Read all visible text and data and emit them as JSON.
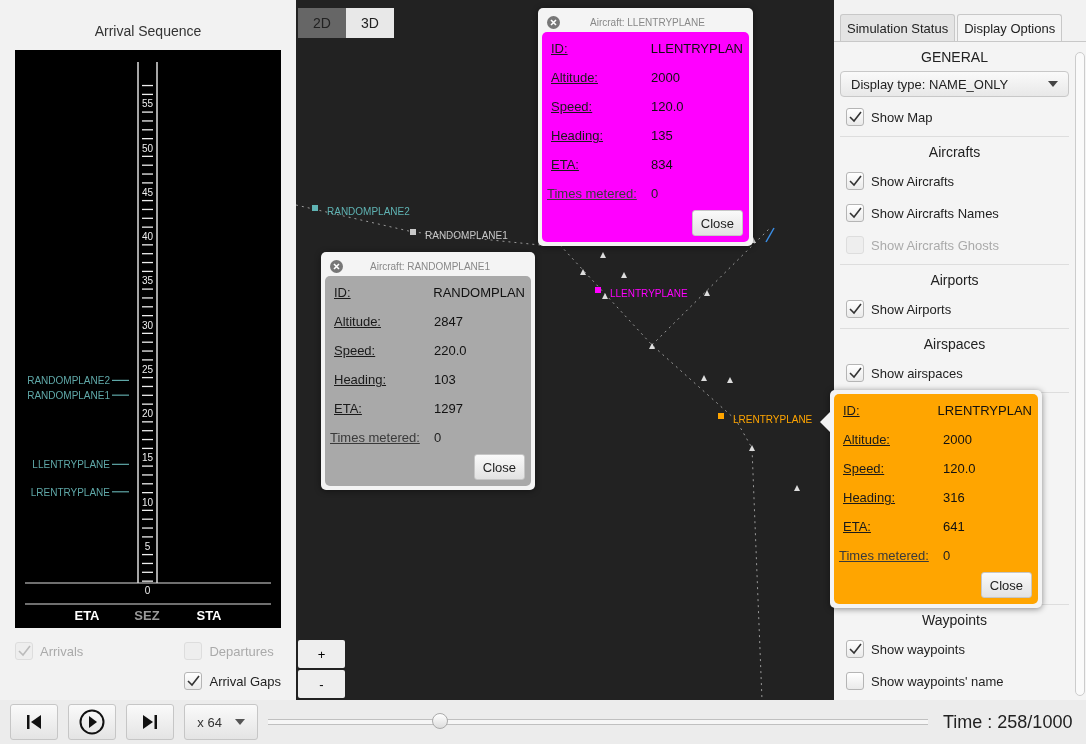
{
  "arrival_sequence": {
    "title": "Arrival Sequence",
    "scale_labels": [
      "55",
      "50",
      "45",
      "40",
      "35",
      "30",
      "25",
      "20",
      "15",
      "10",
      "5",
      "0"
    ],
    "flights": [
      "RANDOMPLANE2",
      "RANDOMPLANE1",
      "LLENTRYPLANE",
      "LRENTRYPLANE"
    ],
    "columns": [
      {
        "label": "ETA",
        "disabled": false
      },
      {
        "label": "SEZ",
        "disabled": true
      },
      {
        "label": "STA",
        "disabled": false
      }
    ],
    "options": [
      {
        "label": "Arrivals",
        "checked": true,
        "disabled": true
      },
      {
        "label": "Departures",
        "checked": false,
        "disabled": true
      },
      {
        "label": "Arrival Gaps",
        "checked": true,
        "disabled": false
      }
    ]
  },
  "map": {
    "view_buttons": [
      {
        "label": "2D",
        "selected": true
      },
      {
        "label": "3D",
        "selected": false
      }
    ],
    "aircraft": [
      {
        "label": "RANDOMPLANE2",
        "color": "#5fb3b3"
      },
      {
        "label": "RANDOMPLANE1",
        "color": "#c8c8c8"
      },
      {
        "label": "LLENTRYPLANE",
        "color": "#ff00ff"
      },
      {
        "label": "LRENTRYPLANE",
        "color": "#ffa500"
      }
    ],
    "zoom_buttons": [
      "+",
      "-"
    ]
  },
  "popups": [
    {
      "title": "Aircraft: LLENTRYPLANE",
      "color": "#ff00ff",
      "fields": [
        {
          "label": "ID:",
          "value": "LLENTRYPLAN",
          "kind": "property"
        },
        {
          "label": "Altitude:",
          "value": "2000",
          "kind": "property"
        },
        {
          "label": "Speed:",
          "value": "120.0",
          "kind": "property"
        },
        {
          "label": "Heading:",
          "value": "135",
          "kind": "property"
        },
        {
          "label": "ETA:",
          "value": "834",
          "kind": "property"
        },
        {
          "label": "Times metered:",
          "value": "0",
          "kind": "count"
        }
      ],
      "button": "Close"
    },
    {
      "title": "Aircraft: RANDOMPLANE1",
      "color": "#a9a9a9",
      "fields": [
        {
          "label": "ID:",
          "value": "RANDOMPLAN",
          "kind": "property"
        },
        {
          "label": "Altitude:",
          "value": "2847",
          "kind": "property"
        },
        {
          "label": "Speed:",
          "value": "220.0",
          "kind": "property"
        },
        {
          "label": "Heading:",
          "value": "103",
          "kind": "property"
        },
        {
          "label": "ETA:",
          "value": "1297",
          "kind": "property"
        },
        {
          "label": "Times metered:",
          "value": "0",
          "kind": "count"
        }
      ],
      "button": "Close"
    },
    {
      "color": "#ffa500",
      "fields": [
        {
          "label": "ID:",
          "value": "LRENTRYPLAN",
          "kind": "property"
        },
        {
          "label": "Altitude:",
          "value": "2000",
          "kind": "property"
        },
        {
          "label": "Speed:",
          "value": "120.0",
          "kind": "property"
        },
        {
          "label": "Heading:",
          "value": "316",
          "kind": "property"
        },
        {
          "label": "ETA:",
          "value": "641",
          "kind": "property"
        },
        {
          "label": "Times metered:",
          "value": "0",
          "kind": "count"
        }
      ],
      "button": "Close"
    }
  ],
  "side_panel": {
    "tabs": [
      {
        "label": "Simulation Status",
        "selected": false
      },
      {
        "label": "Display Options",
        "selected": true
      }
    ],
    "sections": [
      {
        "title": "GENERAL",
        "controls": [
          {
            "kind": "dropdown",
            "value": "Display type: NAME_ONLY"
          },
          {
            "kind": "checkbox",
            "label": "Show Map",
            "checked": true,
            "disabled": false
          }
        ]
      },
      {
        "title": "Aircrafts",
        "controls": [
          {
            "kind": "checkbox",
            "label": "Show Aircrafts",
            "checked": true,
            "disabled": false
          },
          {
            "kind": "checkbox",
            "label": "Show Aircrafts Names",
            "checked": true,
            "disabled": false
          },
          {
            "kind": "checkbox",
            "label": "Show Aircrafts Ghosts",
            "checked": false,
            "disabled": true
          }
        ]
      },
      {
        "title": "Airports",
        "controls": [
          {
            "kind": "checkbox",
            "label": "Show Airports",
            "checked": true,
            "disabled": false
          }
        ]
      },
      {
        "title": "Airspaces",
        "controls": [
          {
            "kind": "checkbox",
            "label": "Show airspaces",
            "checked": true,
            "disabled": false
          }
        ]
      },
      {
        "title": "Waypoints",
        "controls": [
          {
            "kind": "checkbox",
            "label": "Show waypoints",
            "checked": true,
            "disabled": false
          },
          {
            "kind": "checkbox",
            "label": "Show waypoints' name",
            "checked": false,
            "disabled": false
          }
        ]
      }
    ]
  },
  "player": {
    "speed": "x 64",
    "progress": {
      "level": 0.26
    },
    "time": "Time : 258/1000"
  }
}
